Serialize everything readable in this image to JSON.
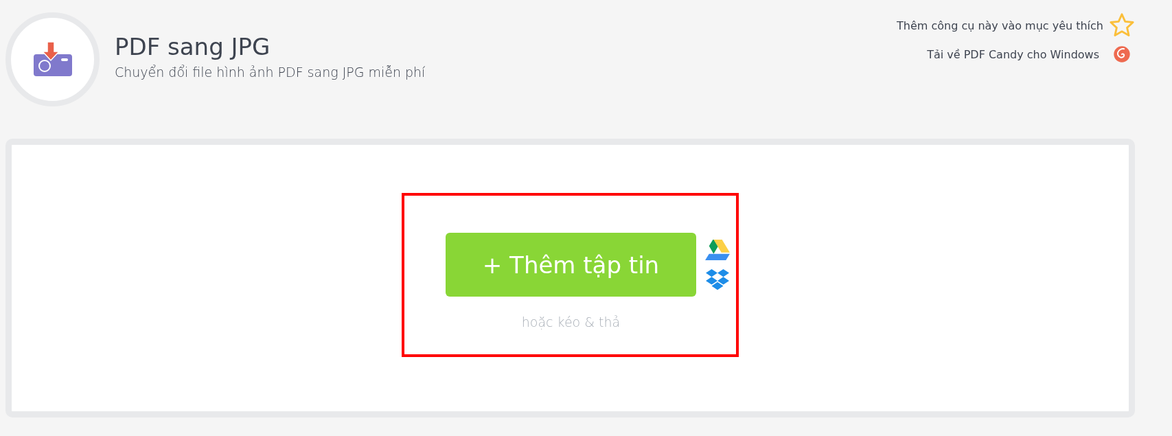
{
  "header": {
    "title": "PDF sang JPG",
    "subtitle": "Chuyển đổi file hình ảnh PDF sang JPG miễn phí"
  },
  "links": [
    {
      "kind": "favorite",
      "label": "Thêm công cụ này vào mục yêu thích"
    },
    {
      "kind": "download",
      "label": "Tải về PDF Candy cho Windows"
    }
  ],
  "upload": {
    "button": "+ Thêm tập tin",
    "hint": "hoặc kéo & thả"
  }
}
